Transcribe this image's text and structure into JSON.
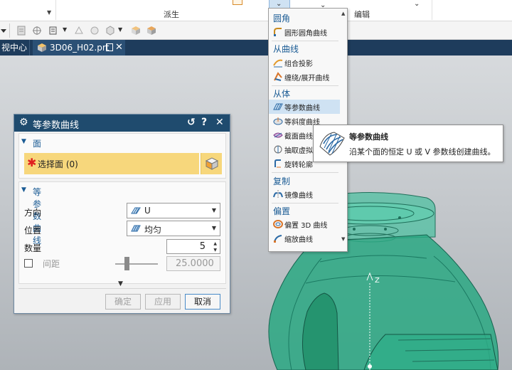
{
  "colors": {
    "title_bar": "#1f4b6e",
    "tab_bar": "#1e3c5c",
    "section_header": "#1a5b94",
    "selection_highlight": "#f7d77c",
    "required_star": "#e0201f",
    "model_green": "#2aa882"
  },
  "ribbon": {
    "group_derived": "派生",
    "group_edit": "编辑"
  },
  "tabs": {
    "left_tab": "视中心",
    "active_tab": "3D06_H02.prt"
  },
  "dialog": {
    "title": "等参数曲线",
    "title_buttons": [
      "↺",
      "?",
      "✕"
    ],
    "section_face": {
      "header": "面",
      "select_label": "选择面 (0)"
    },
    "section_isoparm": {
      "header": "等参数曲线",
      "direction_label": "方向",
      "direction_value": "U",
      "position_label": "位置",
      "position_value": "均匀",
      "count_label": "数量",
      "count_value": "5",
      "spacing_label": "间距",
      "spacing_value": "25.0000",
      "spacing_checked": false
    },
    "buttons": {
      "ok": "确定",
      "apply": "应用",
      "cancel": "取消"
    }
  },
  "menu": {
    "groups": [
      {
        "header": "圆角",
        "items": [
          {
            "label": "圆形圆角曲线",
            "icon": "circular-fillet-curve-icon"
          }
        ]
      },
      {
        "header": "从曲线",
        "items": [
          {
            "label": "组合投影",
            "icon": "combined-projection-icon"
          },
          {
            "label": "缠绕/展开曲线",
            "icon": "wrap-unwrap-curve-icon"
          }
        ]
      },
      {
        "header": "从体",
        "items": [
          {
            "label": "等参数曲线",
            "icon": "isoparametric-curve-icon",
            "highlighted": true
          },
          {
            "label": "等斜度曲线",
            "icon": "isocline-curve-icon"
          },
          {
            "label": "截面曲线",
            "icon": "section-curve-icon"
          },
          {
            "label": "抽取虚拟",
            "icon": "extract-virtual-curve-icon"
          },
          {
            "label": "旋转轮廓",
            "icon": "rotate-profile-icon"
          }
        ]
      },
      {
        "header": "复制",
        "items": [
          {
            "label": "镜像曲线",
            "icon": "mirror-curve-icon"
          }
        ]
      },
      {
        "header": "偏置",
        "items": [
          {
            "label": "偏置 3D 曲线",
            "icon": "offset-3d-curve-icon"
          },
          {
            "label": "缩放曲线",
            "icon": "scale-curve-icon"
          }
        ]
      }
    ]
  },
  "tooltip": {
    "title": "等参数曲线",
    "description": "沿某个面的恒定 U 或 V 参数线创建曲线。"
  },
  "viewport": {
    "axis_label": "Z"
  }
}
